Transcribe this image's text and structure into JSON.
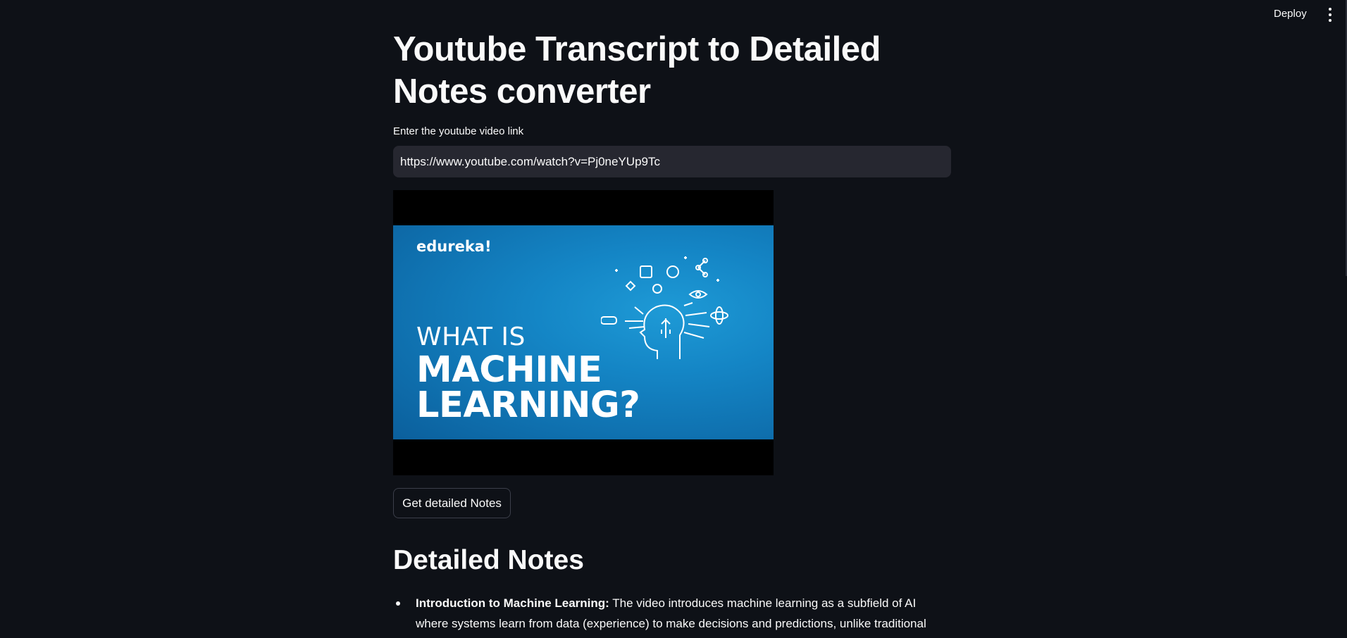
{
  "header": {
    "deploy_label": "Deploy",
    "menu_icon": "vertical-ellipsis-icon"
  },
  "main": {
    "title": "Youtube Transcript to Detailed Notes converter",
    "input": {
      "label": "Enter the youtube video link",
      "value": "https://www.youtube.com/watch?v=Pj0neYUp9Tc"
    },
    "thumbnail": {
      "brand": "edureka!",
      "line1": "WHAT IS",
      "line2": "MACHINE",
      "line3": "LEARNING?"
    },
    "button_label": "Get detailed Notes",
    "notes_heading": "Detailed Notes",
    "notes": [
      {
        "title": "Introduction to Machine Learning:",
        "text": " The video introduces machine learning as a subfield of AI where systems learn from data (experience) to make decisions and predictions, unlike traditional"
      }
    ]
  },
  "colors": {
    "background": "#0e1117",
    "input_background": "#262730",
    "text": "#fafafa",
    "thumbnail_blue": "#1485c5"
  }
}
